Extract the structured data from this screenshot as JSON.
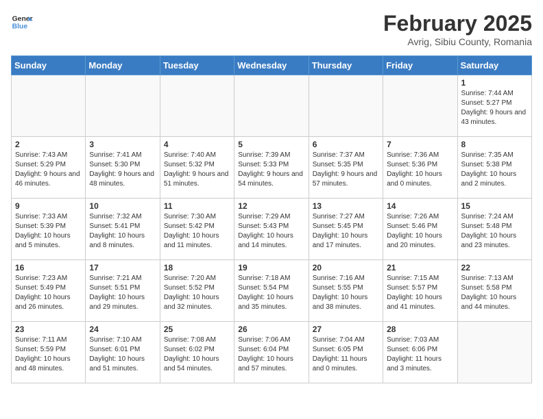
{
  "header": {
    "logo_general": "General",
    "logo_blue": "Blue",
    "month": "February 2025",
    "location": "Avrig, Sibiu County, Romania"
  },
  "weekdays": [
    "Sunday",
    "Monday",
    "Tuesday",
    "Wednesday",
    "Thursday",
    "Friday",
    "Saturday"
  ],
  "weeks": [
    [
      {
        "day": "",
        "info": ""
      },
      {
        "day": "",
        "info": ""
      },
      {
        "day": "",
        "info": ""
      },
      {
        "day": "",
        "info": ""
      },
      {
        "day": "",
        "info": ""
      },
      {
        "day": "",
        "info": ""
      },
      {
        "day": "1",
        "info": "Sunrise: 7:44 AM\nSunset: 5:27 PM\nDaylight: 9 hours and 43 minutes."
      }
    ],
    [
      {
        "day": "2",
        "info": "Sunrise: 7:43 AM\nSunset: 5:29 PM\nDaylight: 9 hours and 46 minutes."
      },
      {
        "day": "3",
        "info": "Sunrise: 7:41 AM\nSunset: 5:30 PM\nDaylight: 9 hours and 48 minutes."
      },
      {
        "day": "4",
        "info": "Sunrise: 7:40 AM\nSunset: 5:32 PM\nDaylight: 9 hours and 51 minutes."
      },
      {
        "day": "5",
        "info": "Sunrise: 7:39 AM\nSunset: 5:33 PM\nDaylight: 9 hours and 54 minutes."
      },
      {
        "day": "6",
        "info": "Sunrise: 7:37 AM\nSunset: 5:35 PM\nDaylight: 9 hours and 57 minutes."
      },
      {
        "day": "7",
        "info": "Sunrise: 7:36 AM\nSunset: 5:36 PM\nDaylight: 10 hours and 0 minutes."
      },
      {
        "day": "8",
        "info": "Sunrise: 7:35 AM\nSunset: 5:38 PM\nDaylight: 10 hours and 2 minutes."
      }
    ],
    [
      {
        "day": "9",
        "info": "Sunrise: 7:33 AM\nSunset: 5:39 PM\nDaylight: 10 hours and 5 minutes."
      },
      {
        "day": "10",
        "info": "Sunrise: 7:32 AM\nSunset: 5:41 PM\nDaylight: 10 hours and 8 minutes."
      },
      {
        "day": "11",
        "info": "Sunrise: 7:30 AM\nSunset: 5:42 PM\nDaylight: 10 hours and 11 minutes."
      },
      {
        "day": "12",
        "info": "Sunrise: 7:29 AM\nSunset: 5:43 PM\nDaylight: 10 hours and 14 minutes."
      },
      {
        "day": "13",
        "info": "Sunrise: 7:27 AM\nSunset: 5:45 PM\nDaylight: 10 hours and 17 minutes."
      },
      {
        "day": "14",
        "info": "Sunrise: 7:26 AM\nSunset: 5:46 PM\nDaylight: 10 hours and 20 minutes."
      },
      {
        "day": "15",
        "info": "Sunrise: 7:24 AM\nSunset: 5:48 PM\nDaylight: 10 hours and 23 minutes."
      }
    ],
    [
      {
        "day": "16",
        "info": "Sunrise: 7:23 AM\nSunset: 5:49 PM\nDaylight: 10 hours and 26 minutes."
      },
      {
        "day": "17",
        "info": "Sunrise: 7:21 AM\nSunset: 5:51 PM\nDaylight: 10 hours and 29 minutes."
      },
      {
        "day": "18",
        "info": "Sunrise: 7:20 AM\nSunset: 5:52 PM\nDaylight: 10 hours and 32 minutes."
      },
      {
        "day": "19",
        "info": "Sunrise: 7:18 AM\nSunset: 5:54 PM\nDaylight: 10 hours and 35 minutes."
      },
      {
        "day": "20",
        "info": "Sunrise: 7:16 AM\nSunset: 5:55 PM\nDaylight: 10 hours and 38 minutes."
      },
      {
        "day": "21",
        "info": "Sunrise: 7:15 AM\nSunset: 5:57 PM\nDaylight: 10 hours and 41 minutes."
      },
      {
        "day": "22",
        "info": "Sunrise: 7:13 AM\nSunset: 5:58 PM\nDaylight: 10 hours and 44 minutes."
      }
    ],
    [
      {
        "day": "23",
        "info": "Sunrise: 7:11 AM\nSunset: 5:59 PM\nDaylight: 10 hours and 48 minutes."
      },
      {
        "day": "24",
        "info": "Sunrise: 7:10 AM\nSunset: 6:01 PM\nDaylight: 10 hours and 51 minutes."
      },
      {
        "day": "25",
        "info": "Sunrise: 7:08 AM\nSunset: 6:02 PM\nDaylight: 10 hours and 54 minutes."
      },
      {
        "day": "26",
        "info": "Sunrise: 7:06 AM\nSunset: 6:04 PM\nDaylight: 10 hours and 57 minutes."
      },
      {
        "day": "27",
        "info": "Sunrise: 7:04 AM\nSunset: 6:05 PM\nDaylight: 11 hours and 0 minutes."
      },
      {
        "day": "28",
        "info": "Sunrise: 7:03 AM\nSunset: 6:06 PM\nDaylight: 11 hours and 3 minutes."
      },
      {
        "day": "",
        "info": ""
      }
    ]
  ]
}
